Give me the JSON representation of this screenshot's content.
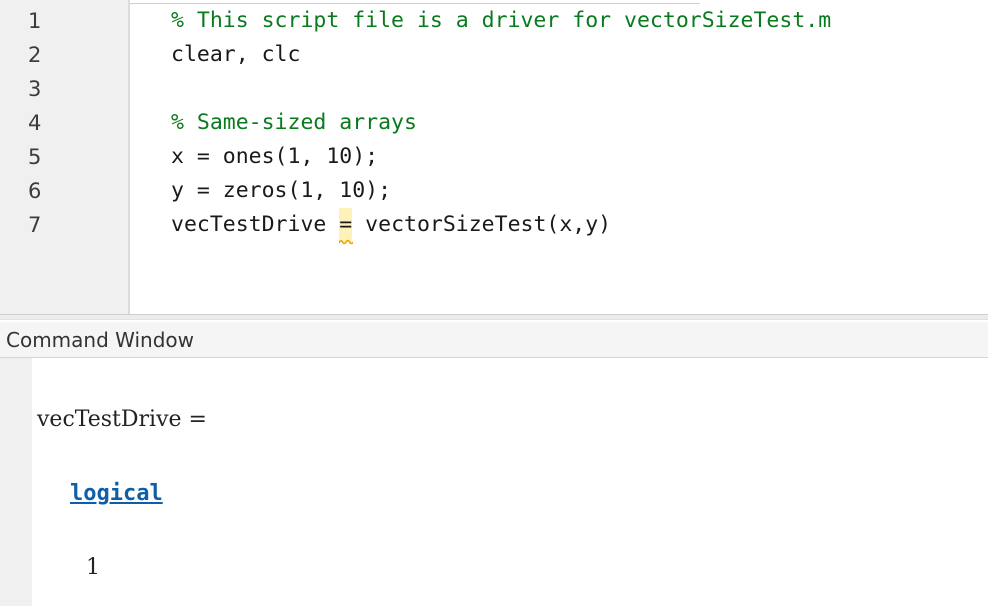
{
  "editor": {
    "lines": [
      {
        "num": "1",
        "text": "% This script file is a driver for vectorSizeTest.m"
      },
      {
        "num": "2",
        "text": "clear, clc"
      },
      {
        "num": "3",
        "text": ""
      },
      {
        "num": "4",
        "text": "% Same-sized arrays"
      },
      {
        "num": "5",
        "text": "x = ones(1, 10);"
      },
      {
        "num": "6",
        "text": "y = zeros(1, 10);"
      },
      {
        "num": "7",
        "before": "vecTestDrive ",
        "warn": "=",
        "after": " vectorSizeTest(x,y)"
      }
    ]
  },
  "command_window": {
    "title": "Command Window",
    "output_var": "vecTestDrive =",
    "class_link": "logical",
    "value": "1"
  },
  "colors": {
    "comment": "#0a7a1e",
    "link": "#0e5fa8",
    "warning_underline": "#e6a700"
  }
}
